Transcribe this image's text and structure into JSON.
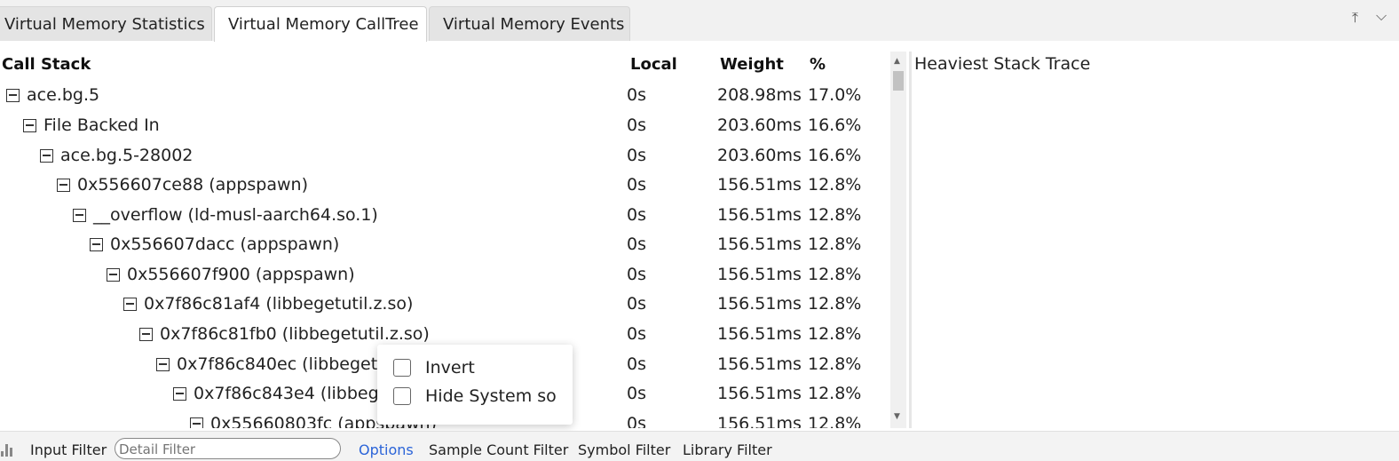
{
  "tabs": [
    {
      "label": "Virtual Memory Statistics",
      "active": false
    },
    {
      "label": "Virtual Memory CallTree",
      "active": true
    },
    {
      "label": "Virtual Memory Events",
      "active": false
    }
  ],
  "tab_controls": {
    "collapse_icon": "⤒",
    "expand_icon": "⌵"
  },
  "table": {
    "headers": {
      "call_stack": "Call Stack",
      "local": "Local",
      "weight": "Weight",
      "percent": "%"
    },
    "rows": [
      {
        "name": "ace.bg.5",
        "local": "0s",
        "weight": "208.98ms",
        "percent": "17.0%",
        "depth": 0
      },
      {
        "name": "File Backed In",
        "local": "0s",
        "weight": "203.60ms",
        "percent": "16.6%",
        "depth": 1
      },
      {
        "name": "ace.bg.5-28002",
        "local": "0s",
        "weight": "203.60ms",
        "percent": "16.6%",
        "depth": 2
      },
      {
        "name": "0x556607ce88 (appspawn)",
        "local": "0s",
        "weight": "156.51ms",
        "percent": "12.8%",
        "depth": 3
      },
      {
        "name": "__overflow (ld-musl-aarch64.so.1)",
        "local": "0s",
        "weight": "156.51ms",
        "percent": "12.8%",
        "depth": 4
      },
      {
        "name": "0x556607dacc (appspawn)",
        "local": "0s",
        "weight": "156.51ms",
        "percent": "12.8%",
        "depth": 5
      },
      {
        "name": "0x556607f900 (appspawn)",
        "local": "0s",
        "weight": "156.51ms",
        "percent": "12.8%",
        "depth": 6
      },
      {
        "name": "0x7f86c81af4 (libbegetutil.z.so)",
        "local": "0s",
        "weight": "156.51ms",
        "percent": "12.8%",
        "depth": 7
      },
      {
        "name": "0x7f86c81fb0 (libbegetutil.z.so)",
        "local": "0s",
        "weight": "156.51ms",
        "percent": "12.8%",
        "depth": 8
      },
      {
        "name": "0x7f86c840ec (libbeget",
        "local": "0s",
        "weight": "156.51ms",
        "percent": "12.8%",
        "depth": 9
      },
      {
        "name": "0x7f86c843e4 (libbeg",
        "local": "0s",
        "weight": "156.51ms",
        "percent": "12.8%",
        "depth": 10
      },
      {
        "name": "0x55660803fc (appspawn)",
        "local": "0s",
        "weight": "156.51ms",
        "percent": "12.8%",
        "depth": 11
      }
    ]
  },
  "heaviest_stack_title": "Heaviest Stack Trace",
  "options_popup": {
    "items": [
      {
        "label": "Invert",
        "checked": false
      },
      {
        "label": "Hide System so",
        "checked": false
      }
    ]
  },
  "bottom_bar": {
    "input_filter_label": "Input Filter",
    "detail_filter_placeholder": "Detail Filter",
    "options_label": "Options",
    "sample_count_label": "Sample Count Filter",
    "symbol_filter_label": "Symbol Filter",
    "library_filter_label": "Library Filter",
    "options_color": "#2b64d8"
  }
}
